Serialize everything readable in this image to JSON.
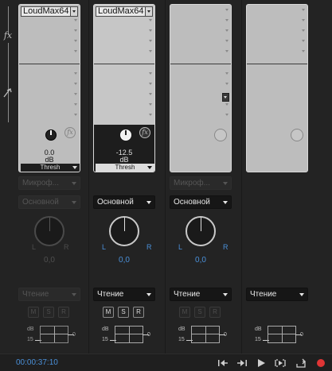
{
  "left_strip": {
    "fx_label": "fx"
  },
  "tracks": [
    {
      "plugin": "LoudMax64",
      "param_value": "0.0",
      "param_unit": "dB",
      "param_name": "Thresh",
      "input": "Микроф...",
      "output": "Основной",
      "pan_value": "0,0",
      "pan_l": "L",
      "pan_r": "R",
      "automation": "Чтение",
      "btn_m": "M",
      "btn_s": "S",
      "btn_r": "R",
      "meter_db": "dB",
      "meter_15": "15",
      "meter_0": "0"
    },
    {
      "plugin": "LoudMax64",
      "param_value": "-12.5",
      "param_unit": "dB",
      "param_name": "Thresh",
      "output": "Основной",
      "pan_value": "0,0",
      "pan_l": "L",
      "pan_r": "R",
      "automation": "Чтение",
      "btn_m": "M",
      "btn_s": "S",
      "btn_r": "R",
      "meter_db": "dB",
      "meter_15": "15",
      "meter_0": "0"
    },
    {
      "input": "Микроф...",
      "output": "Основной",
      "pan_value": "0,0",
      "pan_l": "L",
      "pan_r": "R",
      "automation": "Чтение",
      "btn_m": "M",
      "btn_s": "S",
      "btn_r": "R",
      "meter_db": "dB",
      "meter_15": "15",
      "meter_0": "0"
    },
    {
      "automation": "Чтение",
      "meter_db": "dB",
      "meter_15": "15",
      "meter_0": "0"
    }
  ],
  "transport": {
    "timecode": "00:00:37:10",
    "icons": [
      "go-to-start-icon",
      "go-to-end-icon",
      "play-icon",
      "loop-play-icon",
      "loop-icon",
      "record-icon"
    ]
  },
  "colors": {
    "accent": "#4a90d9",
    "record": "#e03535"
  }
}
